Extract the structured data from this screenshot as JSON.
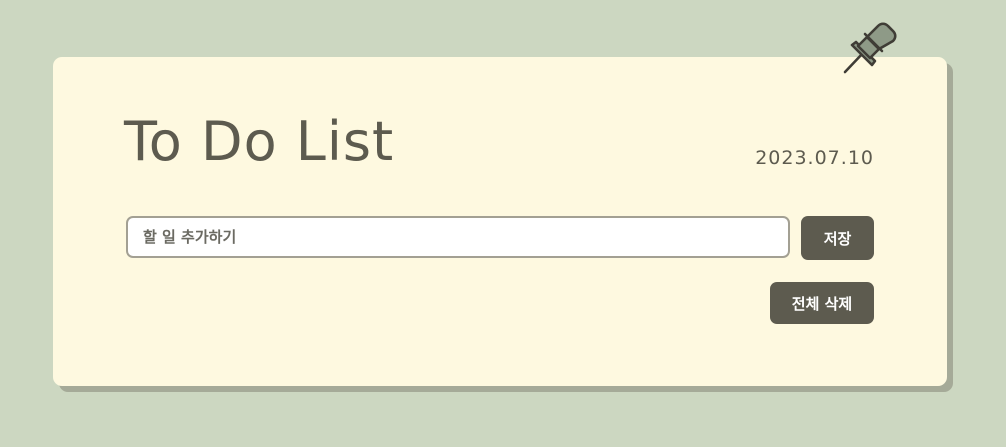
{
  "app": {
    "title": "To Do List",
    "date": "2023.07.10"
  },
  "input": {
    "placeholder": "할 일 추가하기",
    "value": ""
  },
  "buttons": {
    "save_label": "저장",
    "clear_all_label": "전체 삭제"
  },
  "icons": {
    "pin": "pushpin-icon"
  },
  "colors": {
    "background": "#ccd7c1",
    "card": "#fef9e0",
    "card_shadow": "#a5aa98",
    "text": "#5d5b4f",
    "button": "#5d5b4f",
    "button_text": "#ffffff",
    "pin_fill": "#8e9a87"
  }
}
